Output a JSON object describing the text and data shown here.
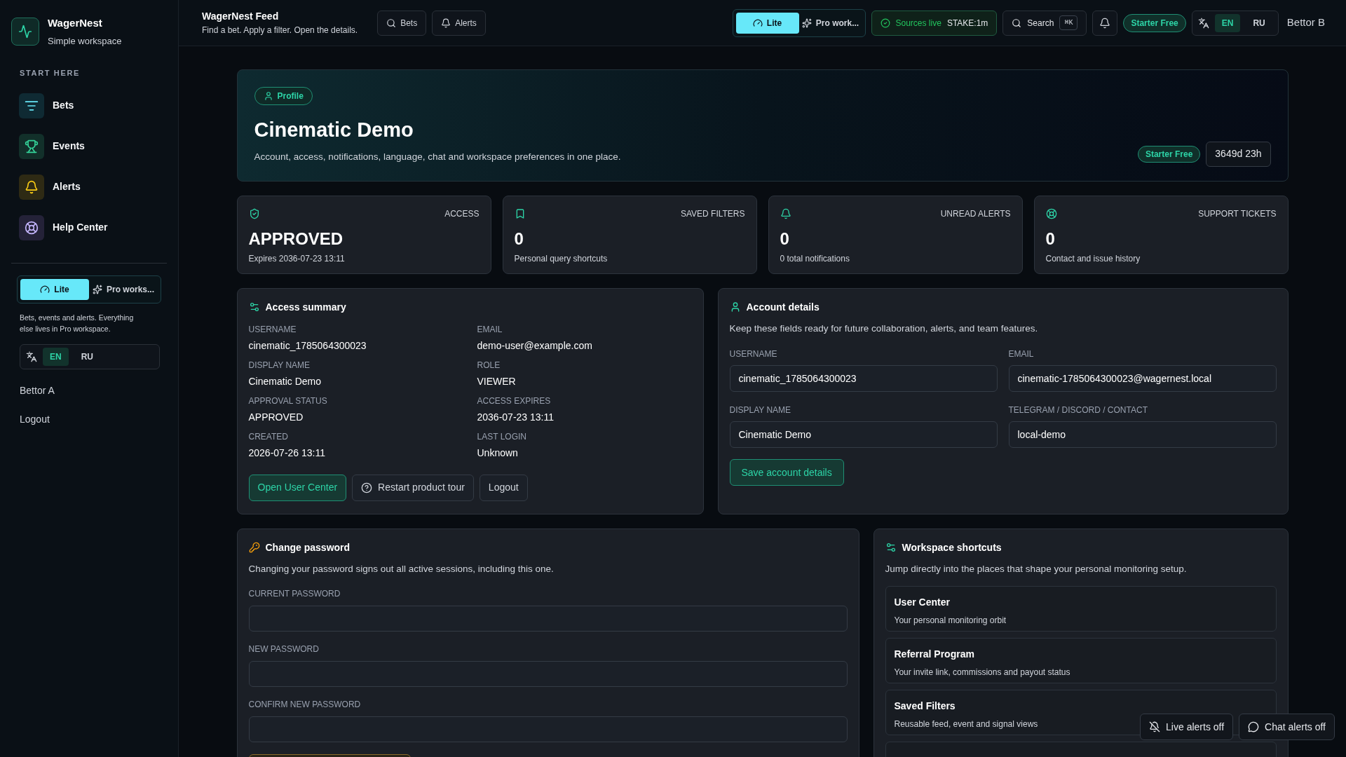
{
  "sidebar": {
    "brand": {
      "name": "WagerNest",
      "tagline": "Simple workspace"
    },
    "section_label": "START HERE",
    "items": [
      {
        "label": "Bets",
        "kind": "filter"
      },
      {
        "label": "Events",
        "kind": "trophy"
      },
      {
        "label": "Alerts",
        "kind": "bell"
      },
      {
        "label": "Help Center",
        "kind": "help"
      }
    ],
    "mode_switch": [
      {
        "label": "Lite",
        "kind": "lite",
        "selected": true
      },
      {
        "label": "Pro works...",
        "kind": "pro",
        "selected": false
      }
    ],
    "mode_note": "Bets, events and alerts. Everything else lives in Pro workspace.",
    "languages": [
      {
        "label": "EN",
        "selected": true
      },
      {
        "label": "RU",
        "selected": false
      }
    ],
    "user": "Bettor A",
    "logout": "Logout"
  },
  "topbar": {
    "title": "WagerNest Feed",
    "subtitle": "Find a bet. Apply a filter. Open the details.",
    "quick_links": [
      {
        "label": "Bets",
        "kind": "search"
      },
      {
        "label": "Alerts",
        "kind": "bell"
      }
    ],
    "mode_switch": [
      {
        "label": "Lite",
        "kind": "lite",
        "selected": true
      },
      {
        "label": "Pro work...",
        "kind": "pro",
        "selected": false
      }
    ],
    "sources": {
      "label": "Sources live",
      "detail": "STAKE:1m"
    },
    "search": {
      "label": "Search",
      "shortcut": "⌘K"
    },
    "plan": "Starter Free",
    "languages": [
      {
        "label": "EN",
        "selected": true
      },
      {
        "label": "RU",
        "selected": false
      }
    ],
    "user": "Bettor B"
  },
  "header": {
    "badge": "Profile",
    "title": "Cinematic Demo",
    "subtitle": "Account, access, notifications, language, chat and workspace preferences in one place.",
    "plan": "Starter Free",
    "remaining": "3649d 23h"
  },
  "stats": [
    {
      "kind": "shield",
      "label": "ACCESS",
      "value": "APPROVED",
      "note": "Expires 2036-07-23 13:11"
    },
    {
      "kind": "bookmark",
      "label": "SAVED FILTERS",
      "value": "0",
      "note": "Personal query shortcuts"
    },
    {
      "kind": "bell",
      "label": "UNREAD ALERTS",
      "value": "0",
      "note": "0 total notifications"
    },
    {
      "kind": "lifebuoy",
      "label": "SUPPORT TICKETS",
      "value": "0",
      "note": "Contact and issue history"
    }
  ],
  "access_summary": {
    "title": "Access summary",
    "fields": [
      {
        "label": "USERNAME",
        "value": "cinematic_1785064300023"
      },
      {
        "label": "EMAIL",
        "value": "demo-user@example.com"
      },
      {
        "label": "DISPLAY NAME",
        "value": "Cinematic Demo"
      },
      {
        "label": "ROLE",
        "value": "VIEWER"
      },
      {
        "label": "APPROVAL STATUS",
        "value": "APPROVED"
      },
      {
        "label": "ACCESS EXPIRES",
        "value": "2036-07-23 13:11"
      },
      {
        "label": "CREATED",
        "value": "2026-07-26 13:11"
      },
      {
        "label": "LAST LOGIN",
        "value": "Unknown"
      }
    ],
    "buttons": [
      {
        "label": "Open User Center",
        "kind": "primary"
      },
      {
        "label": "Restart product tour",
        "kind": "help"
      },
      {
        "label": "Logout",
        "kind": "plain"
      }
    ]
  },
  "account_details": {
    "title": "Account details",
    "description": "Keep these fields ready for future collaboration, alerts, and team features.",
    "fields": [
      {
        "label": "USERNAME",
        "value": "cinematic_1785064300023"
      },
      {
        "label": "EMAIL",
        "value": "cinematic-1785064300023@wagernest.local"
      },
      {
        "label": "DISPLAY NAME",
        "value": "Cinematic Demo"
      },
      {
        "label": "TELEGRAM / DISCORD / CONTACT",
        "value": "local-demo"
      }
    ],
    "save_button": "Save account details"
  },
  "change_password": {
    "title": "Change password",
    "description": "Changing your password signs out all active sessions, including this one.",
    "fields": [
      {
        "label": "CURRENT PASSWORD"
      },
      {
        "label": "NEW PASSWORD"
      },
      {
        "label": "CONFIRM NEW PASSWORD"
      }
    ]
  },
  "workspace_shortcuts": {
    "title": "Workspace shortcuts",
    "description": "Jump directly into the places that shape your personal monitoring setup.",
    "items": [
      {
        "title": "User Center",
        "subtitle": "Your personal monitoring orbit"
      },
      {
        "title": "Referral Program",
        "subtitle": "Your invite link, commissions and payout status"
      },
      {
        "title": "Saved Filters",
        "subtitle": "Reusable feed, event and signal views"
      }
    ]
  },
  "toasts": [
    {
      "label": "Live alerts off",
      "kind": "bell-off"
    },
    {
      "label": "Chat alerts off",
      "kind": "chat"
    }
  ]
}
